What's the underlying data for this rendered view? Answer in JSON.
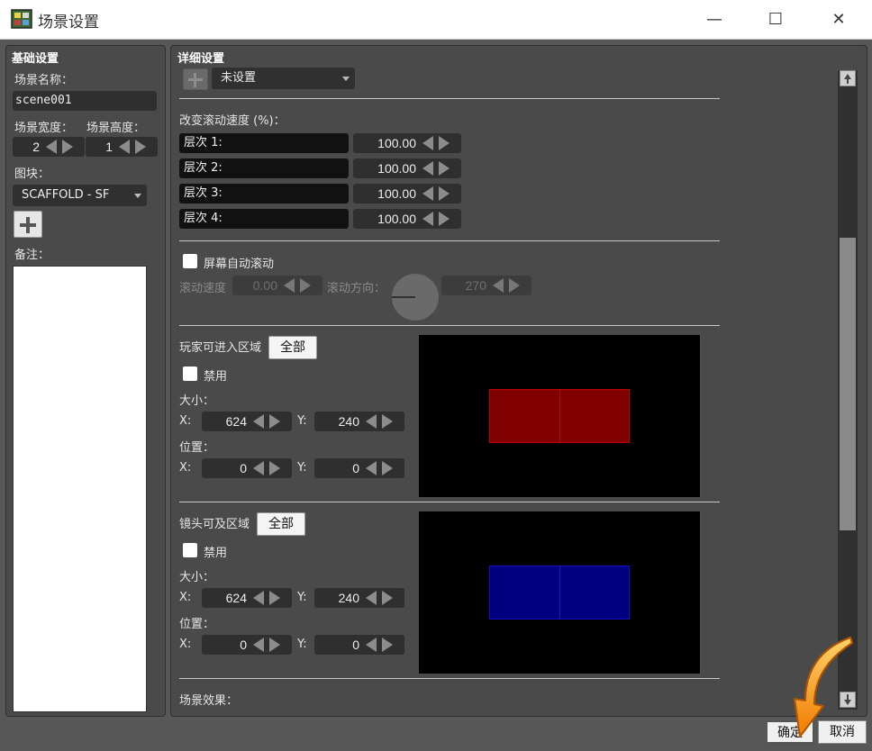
{
  "window": {
    "title": "场景设置",
    "minimize": "—",
    "maximize": "☐",
    "close": "✕"
  },
  "basic": {
    "title": "基础设置",
    "name_label": "场景名称：",
    "name_value": "scene001",
    "width_label": "场景宽度：",
    "height_label": "场景高度：",
    "width_value": "2",
    "height_value": "1",
    "tileset_label": "图块：",
    "tileset_value": "SCAFFOLD - SF",
    "notes_label": "备注："
  },
  "detail": {
    "title": "详细设置",
    "event_dropdown": "未设置",
    "scroll_speed_label": "改变滚动速度 (%)：",
    "layers": [
      {
        "label": "层次 1:",
        "value": "100.00"
      },
      {
        "label": "层次 2:",
        "value": "100.00"
      },
      {
        "label": "层次 3:",
        "value": "100.00"
      },
      {
        "label": "层次 4:",
        "value": "100.00"
      }
    ],
    "auto_scroll_label": "屏幕自动滚动",
    "auto_scroll_speed_label": "滚动速度",
    "auto_scroll_speed_value": "0.00",
    "auto_scroll_dir_label": "滚动方向：",
    "auto_scroll_dir_value": "270",
    "player_area": {
      "label": "玩家可进入区域",
      "all_button": "全部",
      "disable_label": "禁用",
      "size_label": "大小：",
      "pos_label": "位置：",
      "x_label": "X:",
      "y_label": "Y:",
      "size_x": "624",
      "size_y": "240",
      "pos_x": "0",
      "pos_y": "0",
      "color": "#800000"
    },
    "camera_area": {
      "label": "镜头可及区域",
      "all_button": "全部",
      "disable_label": "禁用",
      "size_label": "大小：",
      "pos_label": "位置：",
      "x_label": "X:",
      "y_label": "Y:",
      "size_x": "624",
      "size_y": "240",
      "pos_x": "0",
      "pos_y": "0",
      "color": "#000080"
    },
    "effects_label": "场景效果："
  },
  "footer": {
    "ok": "确定",
    "cancel": "取消"
  },
  "colors": {
    "accent_arrow": "#f39200"
  }
}
